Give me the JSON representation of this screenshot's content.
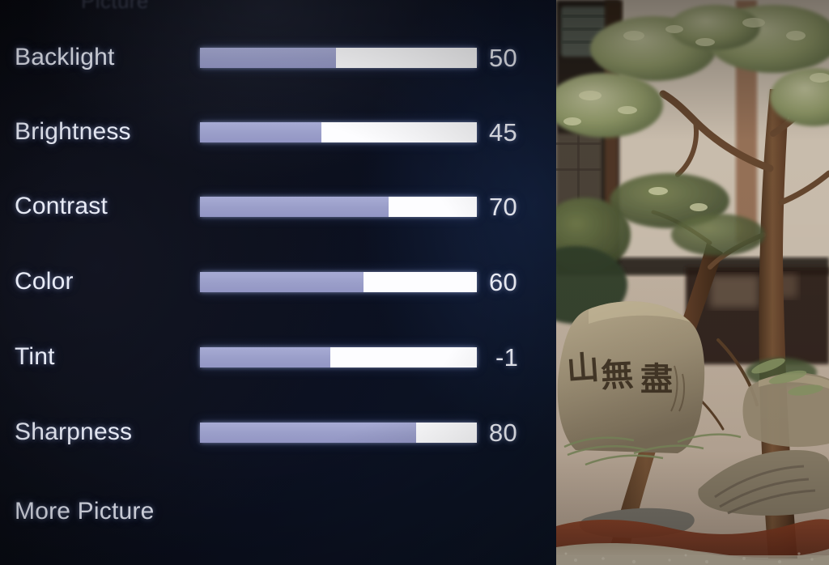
{
  "screen": {
    "device": "television-picture-settings-osd",
    "panel_background_hex": "#0a0e1a",
    "accent_fill_hex": "#9a9ec9",
    "track_hex": "#fdfdff",
    "text_hex": "#e9ecf7"
  },
  "osd": {
    "header_sliver_text": "Picture",
    "settings": [
      {
        "label": "Backlight",
        "value": "50",
        "fill_percent": 49
      },
      {
        "label": "Brightness",
        "value": "45",
        "fill_percent": 44
      },
      {
        "label": "Contrast",
        "value": "70",
        "fill_percent": 68
      },
      {
        "label": "Color",
        "value": "60",
        "fill_percent": 59
      },
      {
        "label": "Tint",
        "value": "-1",
        "fill_percent": 47
      },
      {
        "label": "Sharpness",
        "value": "80",
        "fill_percent": 78
      }
    ],
    "footer_item": {
      "label": "More Picture"
    }
  },
  "preview": {
    "scene_description": "Japanese garden with pruned tree, inscribed stone, gravel and moss",
    "sky_wall_hex": "#cdbfb0",
    "trunk_hex": "#6a4a33",
    "foliage_hex": "#8a9166",
    "stone_hex": "#a89878",
    "gravel_hex": "#c9bca6",
    "moss_hex": "#8a3d28"
  }
}
